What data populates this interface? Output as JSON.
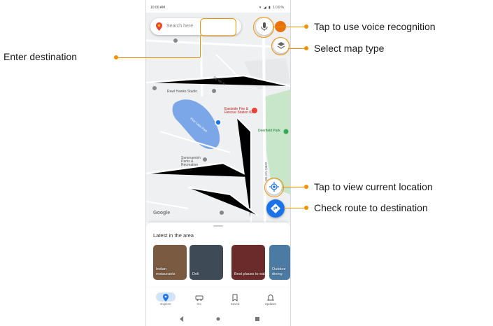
{
  "status_bar": {
    "time": "10:00 AM",
    "battery": "100%"
  },
  "search": {
    "placeholder": "Search here"
  },
  "map": {
    "poi_rawhawks": "Rawl Hawks Studio",
    "poi_fire": "Eastside Fire & Rescue Station 82",
    "poi_lake": "Pine Lake Park",
    "poi_deerfield": "Deerfield Park",
    "poi_parks": "Sammamish Parks & Recreation",
    "road_label_1": "NE 4th St",
    "road_label_2": "228th Ave NE",
    "attribution": "Google"
  },
  "sheet": {
    "title": "Latest in the area",
    "cards": [
      {
        "label": "Indian restaurants",
        "color": "#7a5a40"
      },
      {
        "label": "Deli",
        "color": "#3e4a56"
      },
      {
        "label": "Best places to eat",
        "color": "#6b2b2b"
      },
      {
        "label": "Outdoor dining",
        "color": "#4b7aa3"
      }
    ]
  },
  "nav": {
    "items": [
      {
        "label": "Explore",
        "icon": "map-pin-icon"
      },
      {
        "label": "Go",
        "icon": "car-icon"
      },
      {
        "label": "Saved",
        "icon": "bookmark-icon"
      },
      {
        "label": "Updates",
        "icon": "bell-icon"
      }
    ]
  },
  "callouts": {
    "voice": "Tap to use voice recognition",
    "map_type": "Select map type",
    "destination": "Enter destination",
    "current_location": "Tap to view current location",
    "route": "Check route to destination"
  },
  "colors": {
    "accent": "#f39200",
    "brand_blue": "#1a73e8",
    "lake": "#7ba7e8",
    "park": "#c8e6c9"
  }
}
